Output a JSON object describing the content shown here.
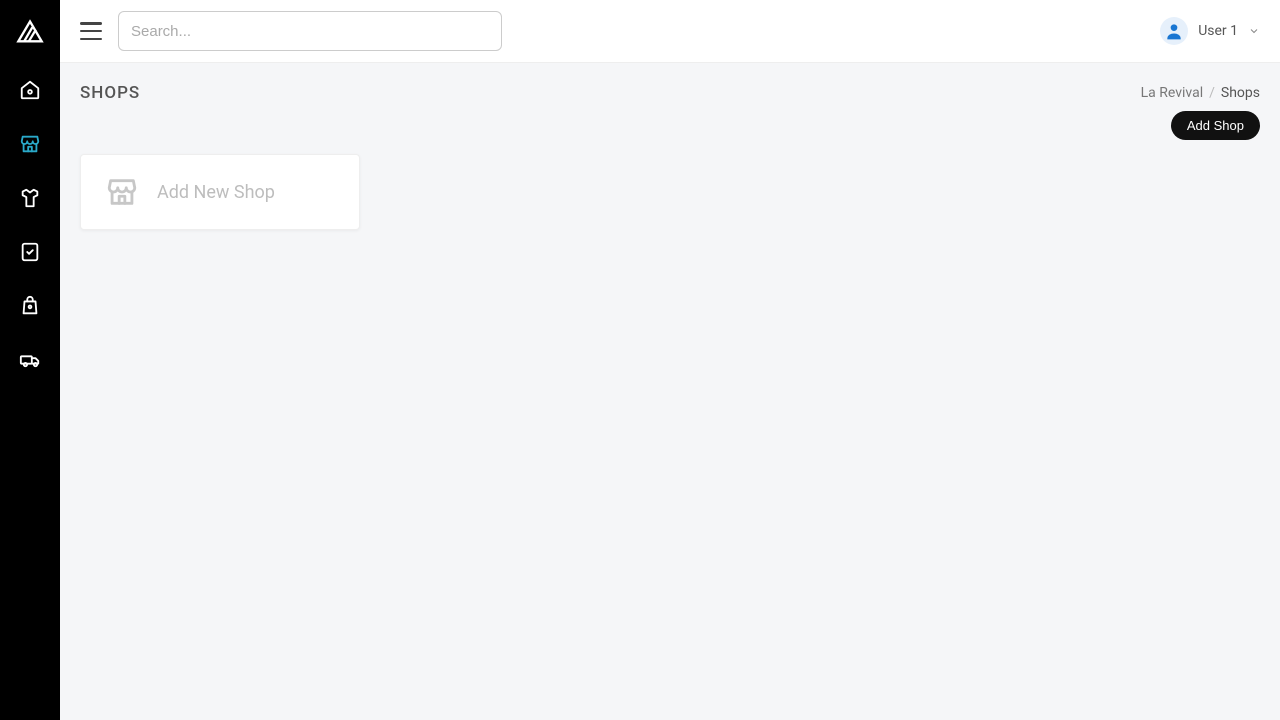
{
  "header": {
    "search_placeholder": "Search...",
    "user_label": "User 1"
  },
  "page": {
    "title": "SHOPS",
    "breadcrumb": {
      "root": "La Revival",
      "current": "Shops"
    },
    "add_button_label": "Add Shop",
    "add_card_label": "Add New Shop"
  },
  "sidebar": {
    "items": [
      {
        "name": "home"
      },
      {
        "name": "shops",
        "active": true
      },
      {
        "name": "products"
      },
      {
        "name": "orders"
      },
      {
        "name": "bags"
      },
      {
        "name": "shipping"
      }
    ]
  }
}
